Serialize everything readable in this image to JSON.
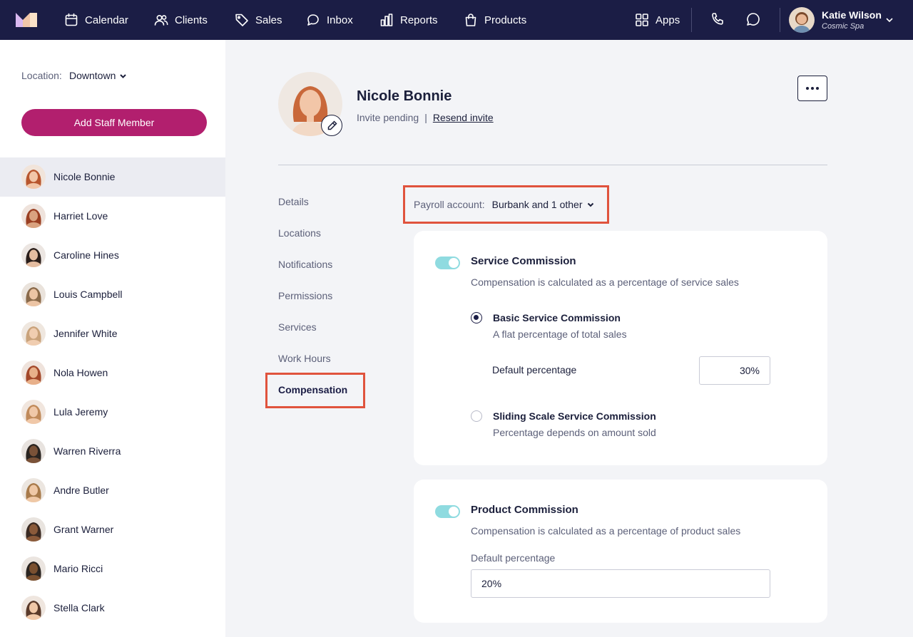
{
  "nav": {
    "items": [
      {
        "label": "Calendar",
        "icon": "calendar-icon"
      },
      {
        "label": "Clients",
        "icon": "users-icon"
      },
      {
        "label": "Sales",
        "icon": "tag-icon"
      },
      {
        "label": "Inbox",
        "icon": "chat-icon"
      },
      {
        "label": "Reports",
        "icon": "bar-chart-icon"
      },
      {
        "label": "Products",
        "icon": "shopping-bag-icon"
      }
    ],
    "apps_label": "Apps",
    "user": {
      "name": "Katie Wilson",
      "business": "Cosmic Spa"
    }
  },
  "sidebar": {
    "location_label": "Location:",
    "location_value": "Downtown",
    "add_button": "Add Staff Member",
    "staff": [
      {
        "name": "Nicole Bonnie",
        "active": true
      },
      {
        "name": "Harriet Love"
      },
      {
        "name": "Caroline Hines"
      },
      {
        "name": "Louis Campbell"
      },
      {
        "name": "Jennifer White"
      },
      {
        "name": "Nola Howen"
      },
      {
        "name": "Lula Jeremy"
      },
      {
        "name": "Warren Riverra"
      },
      {
        "name": "Andre Butler"
      },
      {
        "name": "Grant Warner"
      },
      {
        "name": "Mario Ricci"
      },
      {
        "name": "Stella Clark"
      }
    ]
  },
  "profile": {
    "name": "Nicole Bonnie",
    "status": "Invite pending",
    "separator": "|",
    "resend": "Resend invite"
  },
  "subnav": [
    "Details",
    "Locations",
    "Notifications",
    "Permissions",
    "Services",
    "Work Hours",
    "Compensation"
  ],
  "payroll": {
    "label": "Payroll account:",
    "value": "Burbank and 1 other"
  },
  "service_commission": {
    "title": "Service Commission",
    "description": "Compensation is calculated as a percentage of service sales",
    "enabled": true,
    "basic": {
      "title": "Basic Service Commission",
      "description": "A flat percentage of total sales",
      "selected": true
    },
    "default_label": "Default percentage",
    "default_value": "30%",
    "sliding": {
      "title": "Sliding Scale Service Commission",
      "description": "Percentage depends on amount sold",
      "selected": false
    }
  },
  "product_commission": {
    "title": "Product Commission",
    "description": "Compensation is calculated as a percentage of product sales",
    "enabled": true,
    "default_label": "Default percentage",
    "default_value": "20%"
  },
  "colors": {
    "nav_bg": "#1b1d45",
    "accent_button": "#b21f6e",
    "toggle_on": "#8fdbe0",
    "highlight": "#e0533d"
  }
}
